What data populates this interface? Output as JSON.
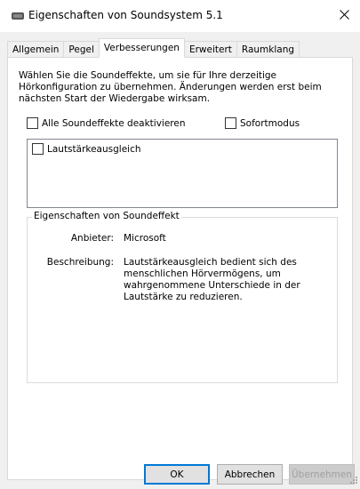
{
  "window": {
    "title": "Eigenschaften von Soundsystem 5.1",
    "icon": "speaker-icon"
  },
  "tabs": [
    {
      "label": "Allgemein",
      "active": false
    },
    {
      "label": "Pegel",
      "active": false
    },
    {
      "label": "Verbesserungen",
      "active": true
    },
    {
      "label": "Erweitert",
      "active": false
    },
    {
      "label": "Raumklang",
      "active": false
    }
  ],
  "enhancements": {
    "description": "Wählen Sie die Soundeffekte, um sie für Ihre derzeitige Hörkonfiguration zu übernehmen. Änderungen werden erst beim nächsten Start der Wiedergabe wirksam.",
    "disable_all_label": "Alle Soundeffekte deaktivieren",
    "disable_all_checked": false,
    "immediate_label": "Sofortmodus",
    "immediate_checked": false,
    "effects": [
      {
        "label": "Lautstärkeausgleich",
        "checked": false
      }
    ]
  },
  "properties": {
    "legend": "Eigenschaften von Soundeffekt",
    "provider_label": "Anbieter:",
    "provider_value": "Microsoft",
    "description_label": "Beschreibung:",
    "description_value": "Lautstärkeausgleich bedient sich des menschlichen Hörvermögens, um wahrgenommene Unterschiede in der Lautstärke zu reduzieren."
  },
  "buttons": {
    "ok": "OK",
    "cancel": "Abbrechen",
    "apply": "Übernehmen",
    "apply_enabled": false
  },
  "colors": {
    "accent": "#0078d7",
    "panel": "#ffffff",
    "dialog": "#f0f0f0"
  }
}
